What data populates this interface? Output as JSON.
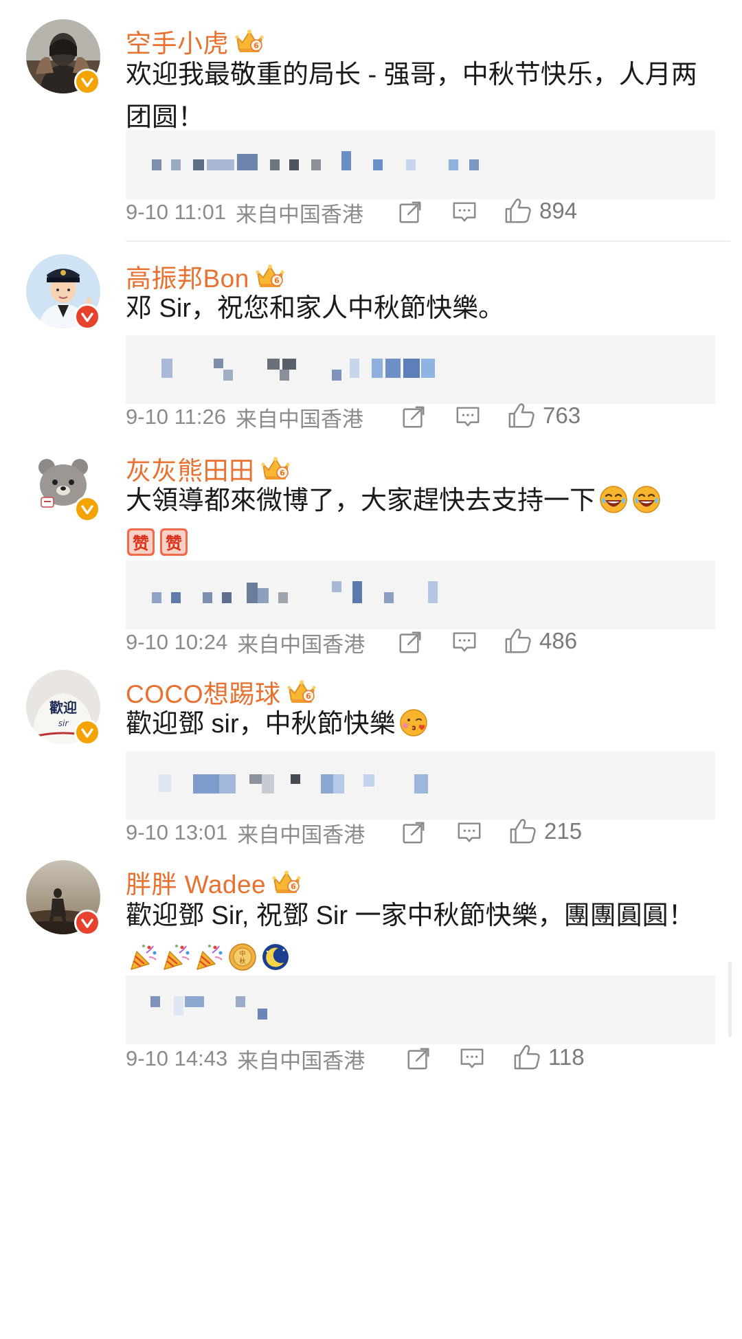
{
  "colors": {
    "username": "#e8712f",
    "verified_gold": "#f5a300",
    "verified_red": "#e8412e",
    "meta_gray": "#8b8b8b",
    "quote_bg": "#f4f4f4"
  },
  "comments": [
    {
      "username": "空手小虎",
      "badge": "crown-vip-6",
      "verified": "gold",
      "text": "欢迎我最敬重的局长 - 强哥，中秋节快乐，人月两团圆！",
      "time": "9-10 11:01",
      "source": "来自中国香港",
      "likes": "894"
    },
    {
      "username": "高振邦Bon",
      "badge": "crown-vip-6",
      "verified": "red",
      "text": "邓 Sir，祝您和家人中秋節快樂。",
      "time": "9-10 11:26",
      "source": "来自中国香港",
      "likes": "763"
    },
    {
      "username": "灰灰熊田田",
      "badge": "crown-vip-6",
      "verified": "gold",
      "text": "大領導都來微博了，大家趕快去支持一下",
      "emojis": [
        "laugh-cry-emoji",
        "laugh-cry-emoji",
        "zan-emoji",
        "zan-emoji"
      ],
      "time": "9-10 10:24",
      "source": "来自中国香港",
      "likes": "486"
    },
    {
      "username": "COCO想踢球",
      "badge": "crown-vip-6",
      "verified": "gold",
      "text": "歡迎鄧 sir，中秋節快樂",
      "emojis": [
        "kiss-emoji"
      ],
      "time": "9-10 13:01",
      "source": "来自中国香港",
      "likes": "215"
    },
    {
      "username": "胖胖 Wadee",
      "badge": "crown-vip-6",
      "verified": "red",
      "text": "歡迎鄧 Sir, 祝鄧 Sir 一家中秋節快樂，團團圓圓！",
      "emojis": [
        "party-popper-emoji",
        "party-popper-emoji",
        "party-popper-emoji",
        "mooncake-emoji",
        "moon-emoji"
      ],
      "time": "9-10 14:43",
      "source": "来自中国香港",
      "likes": "118"
    }
  ]
}
